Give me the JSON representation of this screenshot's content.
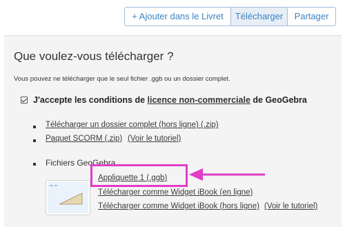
{
  "tabs": {
    "add_label": "+ Ajouter dans le Livret",
    "download_label": "Télécharger",
    "share_label": "Partager"
  },
  "content": {
    "title": "Que voulez-vous télécharger ?",
    "note": "Vous pouvez ne télécharger que le seul fichier .ggb ou un dossier complet.",
    "accept_prefix": "J'accepte les conditions de ",
    "accept_link": "licence non-commerciale",
    "accept_suffix": " de GeoGebra",
    "full_folder_link": "Télécharger un dossier complet (hors ligne) (.zip)",
    "scorm_link": "Paquet SCORM (.zip)",
    "scorm_tutorial_link": "(Voir le tutoriel)",
    "geogebra_files_label": "Fichiers GeoGebra",
    "applet_link": "Appliquette 1 (.ggb)",
    "widget_online_link": "Télécharger comme Widget iBook (en ligne)",
    "widget_offline_link": "Télécharger comme Widget iBook (hors ligne)",
    "widget_tutorial_link": "(Voir le tutoriel)"
  },
  "colors": {
    "accent": "#3a82c4",
    "highlight": "#e23cc8"
  }
}
